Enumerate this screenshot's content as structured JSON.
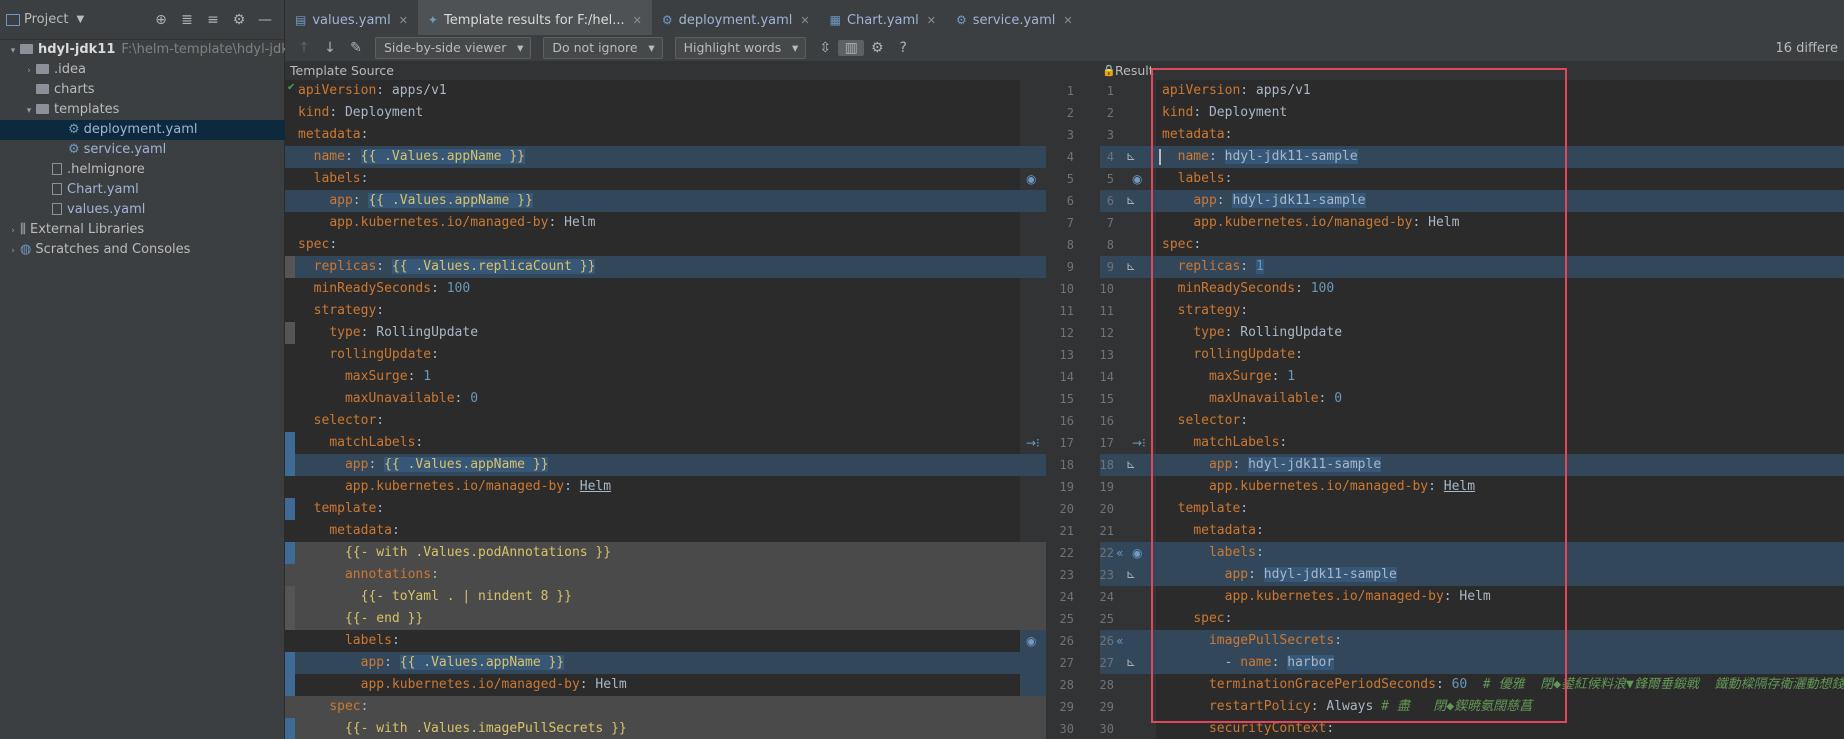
{
  "project": {
    "title": "Project",
    "tree": [
      {
        "label": "hdyl-jdk11",
        "hint": "F:\\helm-template\\hdyl-jdk11",
        "type": "root"
      },
      {
        "label": ".idea",
        "type": "folder"
      },
      {
        "label": "charts",
        "type": "folder"
      },
      {
        "label": "templates",
        "type": "folder-open"
      },
      {
        "label": "deployment.yaml",
        "type": "yaml"
      },
      {
        "label": "service.yaml",
        "type": "yaml"
      },
      {
        "label": ".helmignore",
        "type": "file"
      },
      {
        "label": "Chart.yaml",
        "type": "chart"
      },
      {
        "label": "values.yaml",
        "type": "values"
      },
      {
        "label": "External Libraries",
        "type": "libs"
      },
      {
        "label": "Scratches and Consoles",
        "type": "scratch"
      }
    ]
  },
  "tabs": [
    {
      "label": "values.yaml",
      "icon": "yaml-icon"
    },
    {
      "label": "Template results for F:/hel...",
      "icon": "template-icon",
      "active": true
    },
    {
      "label": "deployment.yaml",
      "icon": "gear-icon"
    },
    {
      "label": "Chart.yaml",
      "icon": "chart-icon"
    },
    {
      "label": "service.yaml",
      "icon": "gear-icon"
    }
  ],
  "toolbar": {
    "viewer": "Side-by-side viewer",
    "ignore": "Do not ignore",
    "highlight": "Highlight words",
    "help": "?",
    "diff_count": "16 differe"
  },
  "panes": {
    "left_title": "Template Source",
    "right_title": "Result"
  },
  "left_lines": [
    "apiVersion: apps/v1",
    "kind: Deployment",
    "metadata:",
    "  name: {{ .Values.appName }}",
    "  labels:",
    "    app: {{ .Values.appName }}",
    "    app.kubernetes.io/managed-by: Helm",
    "spec:",
    "  replicas: {{ .Values.replicaCount }}",
    "  minReadySeconds: 100",
    "  strategy:",
    "    type: RollingUpdate",
    "    rollingUpdate:",
    "      maxSurge: 1",
    "      maxUnavailable: 0",
    "  selector:",
    "    matchLabels:",
    "      app: {{ .Values.appName }}",
    "      app.kubernetes.io/managed-by: Helm",
    "  template:",
    "    metadata:",
    "      {{- with .Values.podAnnotations }}",
    "      annotations:",
    "        {{- toYaml . | nindent 8 }}",
    "      {{- end }}",
    "      labels:",
    "        app: {{ .Values.appName }}",
    "        app.kubernetes.io/managed-by: Helm",
    "    spec:",
    "      {{- with .Values.imagePullSecrets }}"
  ],
  "right_lines": [
    "apiVersion: apps/v1",
    "kind: Deployment",
    "metadata:",
    "  name: hdyl-jdk11-sample",
    "  labels:",
    "    app: hdyl-jdk11-sample",
    "    app.kubernetes.io/managed-by: Helm",
    "spec:",
    "  replicas: 1",
    "  minReadySeconds: 100",
    "  strategy:",
    "    type: RollingUpdate",
    "    rollingUpdate:",
    "      maxSurge: 1",
    "      maxUnavailable: 0",
    "  selector:",
    "    matchLabels:",
    "      app: hdyl-jdk11-sample",
    "      app.kubernetes.io/managed-by: Helm",
    "  template:",
    "    metadata:",
    "      labels:",
    "        app: hdyl-jdk11-sample",
    "        app.kubernetes.io/managed-by: Helm",
    "    spec:",
    "      imagePullSecrets:",
    "        - name: harbor",
    "      terminationGracePeriodSeconds: 60  # 優雅  閉◆鍙紅候料浪▼鋒爾垂鍛戦  鐵動樑隔存衛灑動想錢",
    "      restartPolicy: Always # 盡   閉◆鍥暁氨闊慈菖",
    "      securityContext:"
  ],
  "left_numbers": [
    1,
    2,
    3,
    4,
    5,
    6,
    7,
    8,
    9,
    10,
    11,
    12,
    13,
    14,
    15,
    16,
    17,
    18,
    19,
    20,
    21,
    22,
    23,
    24,
    25,
    26,
    27,
    28,
    29,
    30
  ],
  "right_numbers": [
    1,
    2,
    3,
    4,
    5,
    6,
    7,
    8,
    9,
    10,
    11,
    12,
    13,
    14,
    15,
    16,
    17,
    18,
    19,
    20,
    21,
    22,
    23,
    24,
    25,
    26,
    27,
    28,
    29,
    30
  ],
  "colors": {
    "accent": "#4a88c7",
    "highlight_box": "#e0485a",
    "changed_bg": "#33475a",
    "deleted_bg": "#4a4a4a"
  }
}
